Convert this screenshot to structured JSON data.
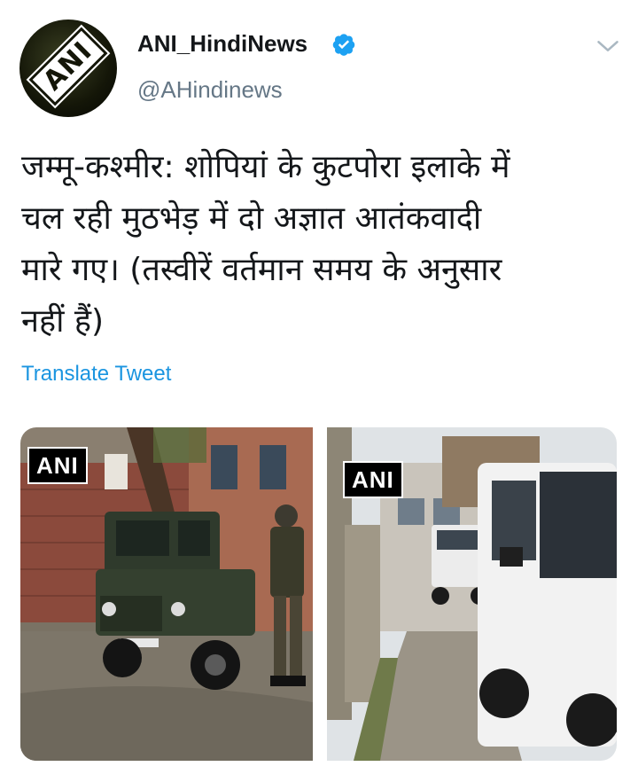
{
  "tweet": {
    "author": {
      "name": "ANI_HindiNews",
      "handle": "@AHindinews",
      "avatar_text": "ANI",
      "verified": true
    },
    "text_lines": [
      "जम्मू-कश्मीर: शोपियां के कुटपोरा इलाके में",
      "चल रही मुठभेड़ में दो अज्ञात आतंकवादी",
      "मारे गए। (तस्वीरें वर्तमान समय के अनुसार",
      "नहीं हैं)"
    ],
    "translate_label": "Translate Tweet",
    "media": [
      {
        "watermark": "ANI"
      },
      {
        "watermark": "ANI"
      }
    ]
  },
  "colors": {
    "text": "#14171a",
    "secondary": "#657786",
    "link": "#1b95e0",
    "verified": "#1da1f2"
  },
  "icons": {
    "verified": "verified-badge-icon",
    "menu": "chevron-down-icon"
  }
}
